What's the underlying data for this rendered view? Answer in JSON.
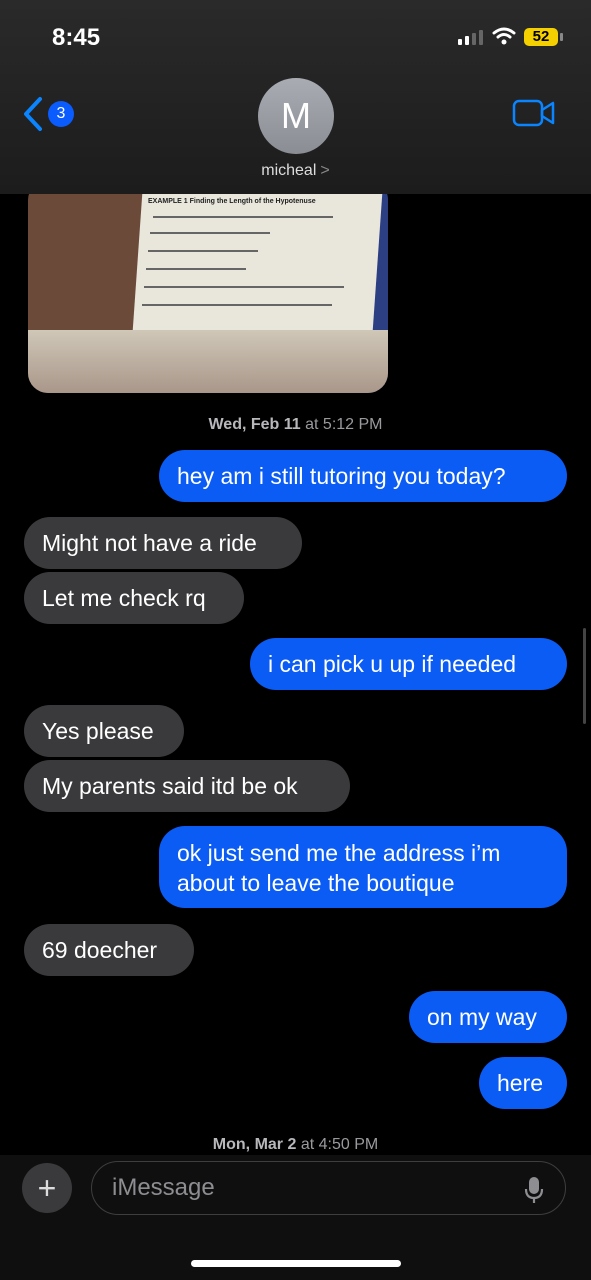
{
  "status_bar": {
    "time": "8:45",
    "battery": "52"
  },
  "header": {
    "back_count": "3",
    "avatar_initial": "M",
    "contact_name": "micheal"
  },
  "photo": {
    "caption": "EXAMPLE 1  Finding the Length of the Hypotenuse"
  },
  "timestamps": [
    {
      "day": "Wed, Feb 11",
      "time": "at 5:12 PM"
    },
    {
      "day": "Mon, Mar 2",
      "time": "at 4:50 PM"
    }
  ],
  "messages": [
    {
      "dir": "out",
      "text": "hey am i still tutoring you today?"
    },
    {
      "dir": "in",
      "text": "Might not have a ride"
    },
    {
      "dir": "in",
      "text": "Let me check rq"
    },
    {
      "dir": "out",
      "text": "i can pick u up if needed"
    },
    {
      "dir": "in",
      "text": "Yes please"
    },
    {
      "dir": "in",
      "text": "My parents said itd be ok"
    },
    {
      "dir": "out",
      "text": "ok just send me the address i’m about to leave the boutique"
    },
    {
      "dir": "in",
      "text": "69 doecher"
    },
    {
      "dir": "out",
      "text": "on my way"
    },
    {
      "dir": "out",
      "text": "here"
    }
  ],
  "input": {
    "placeholder": "iMessage"
  },
  "colors": {
    "outgoing": "#0a5cf5",
    "incoming": "#3a3a3c",
    "badge": "#0a5cff",
    "battery": "#f5d000"
  },
  "icons": [
    "back-chevron-icon",
    "video-call-icon",
    "signal-icon",
    "wifi-icon",
    "battery-icon",
    "plus-icon",
    "microphone-icon",
    "chevron-right-icon"
  ]
}
